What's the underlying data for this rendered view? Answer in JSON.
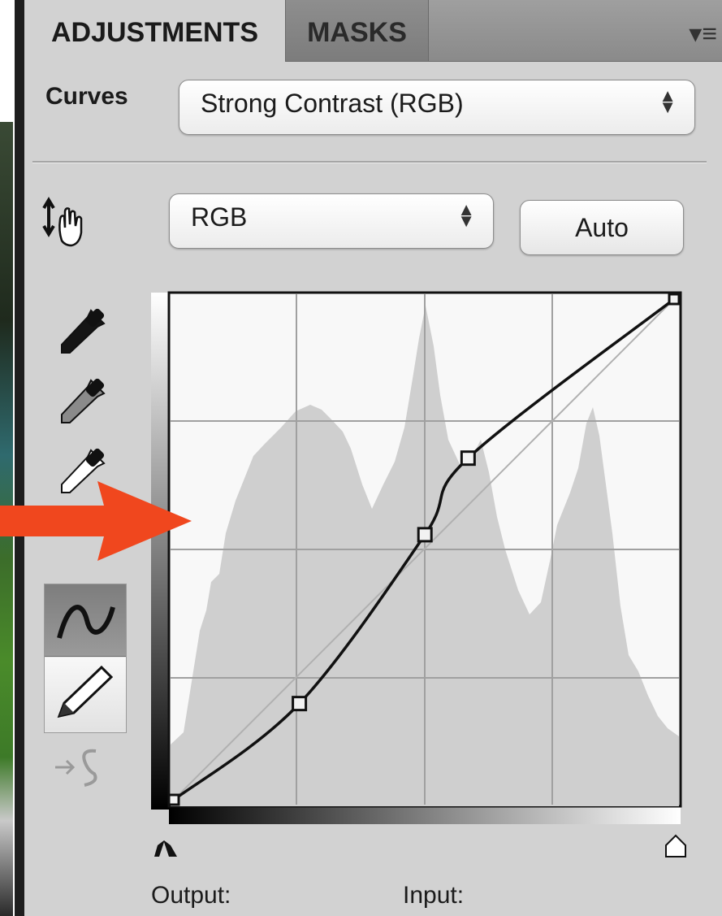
{
  "tabs": [
    {
      "label": "ADJUSTMENTS",
      "active": true
    },
    {
      "label": "MASKS",
      "active": false
    }
  ],
  "panel_menu_icon": "panel-menu-icon",
  "curves_label": "Curves",
  "preset": {
    "value": "Strong Contrast (RGB)"
  },
  "channel": {
    "value": "RGB"
  },
  "auto_label": "Auto",
  "tools": {
    "on_image_adjust": "targeted-adjustment-hand-icon",
    "eyedroppers": [
      "black-point-eyedropper-icon",
      "gray-point-eyedropper-icon",
      "white-point-eyedropper-icon"
    ],
    "curve_mode": "curve-point-icon",
    "pencil_mode": "pencil-icon",
    "smooth": "smooth-curve-icon"
  },
  "output_label": "Output:",
  "input_label": "Input:",
  "curve_points": [
    {
      "input": 0,
      "output": 0
    },
    {
      "input": 64,
      "output": 49
    },
    {
      "input": 128,
      "output": 135
    },
    {
      "input": 150,
      "output": 174
    },
    {
      "input": 255,
      "output": 255
    }
  ],
  "colors": {
    "accent_arrow": "#f0471e",
    "panel_bg": "#d2d2d2",
    "histogram": "#cfcfcf"
  }
}
